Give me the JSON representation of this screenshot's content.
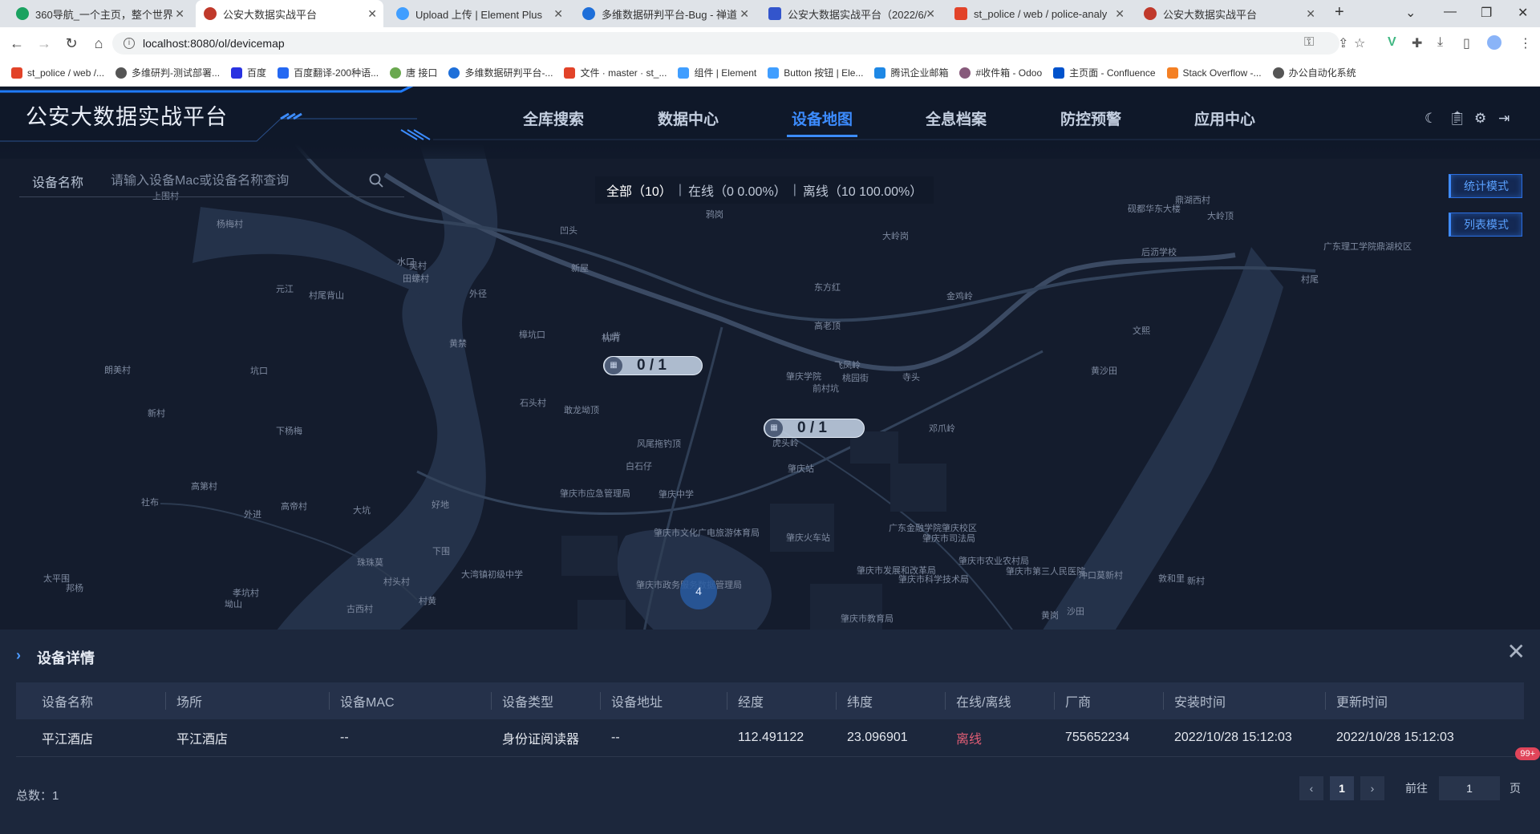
{
  "browser": {
    "tabs": [
      {
        "title": "360导航_一个主页，整个世界",
        "color": "#1aa260"
      },
      {
        "title": "公安大数据实战平台",
        "color": "#c0392b"
      },
      {
        "title": "Upload 上传 | Element Plus",
        "color": "#409eff"
      },
      {
        "title": "多维数据研判平台-Bug - 禅道",
        "color": "#1e6fd9"
      },
      {
        "title": "公安大数据实战平台（2022/6/",
        "color": "#3355cc"
      },
      {
        "title": "st_police / web / police-analy",
        "color": "#e24329"
      },
      {
        "title": "公安大数据实战平台",
        "color": "#c0392b"
      }
    ],
    "new_tab": "+",
    "url": "localhost:8080/ol/devicemap",
    "bookmarks": [
      {
        "label": "st_police / web /...",
        "color": "#e24329"
      },
      {
        "label": "多维研判-测试部署...",
        "color": "#555"
      },
      {
        "label": "百度",
        "color": "#2932e1"
      },
      {
        "label": "百度翻译-200种语...",
        "color": "#2468f2"
      },
      {
        "label": "唐 接口",
        "color": "#6aa84f"
      },
      {
        "label": "多维数据研判平台-...",
        "color": "#1e6fd9"
      },
      {
        "label": "文件 · master · st_...",
        "color": "#e24329"
      },
      {
        "label": "组件 | Element",
        "color": "#409eff"
      },
      {
        "label": "Button 按钮 | Ele...",
        "color": "#409eff"
      },
      {
        "label": "腾讯企业邮箱",
        "color": "#1e88e5"
      },
      {
        "label": "#收件箱 - Odoo",
        "color": "#875a7b"
      },
      {
        "label": "主页面 - Confluence",
        "color": "#0052cc"
      },
      {
        "label": "Stack Overflow -...",
        "color": "#f48024"
      },
      {
        "label": "办公自动化系统",
        "color": "#555"
      }
    ]
  },
  "app": {
    "title": "公安大数据实战平台",
    "nav": [
      "全库搜索",
      "数据中心",
      "设备地图",
      "全息档案",
      "防控预警",
      "应用中心"
    ],
    "active_nav": "设备地图"
  },
  "search": {
    "label": "设备名称",
    "placeholder": "请输入设备Mac或设备名称查询"
  },
  "status": {
    "all": "全部（10）",
    "online": "在线（0   0.00%）",
    "offline": "离线（10   100.00%）"
  },
  "modes": {
    "stats": "统计模式",
    "list": "列表模式"
  },
  "clusters": [
    {
      "label": "0 / 1"
    },
    {
      "label": "0 / 1"
    }
  ],
  "cluster_count": "4",
  "detail": {
    "title": "设备详情",
    "columns": [
      "设备名称",
      "场所",
      "设备MAC",
      "设备类型",
      "设备地址",
      "经度",
      "纬度",
      "在线/离线",
      "厂商",
      "安装时间",
      "更新时间"
    ],
    "rows": [
      [
        "平江酒店",
        "平江酒店",
        "--",
        "身份证阅读器",
        "--",
        "112.491122",
        "23.096901",
        "离线",
        "755652234",
        "2022/10/28 15:12:03",
        "2022/10/28 15:12:03"
      ]
    ],
    "total": "总数：1",
    "page": "1",
    "goto_label": "前往",
    "goto_value": "1",
    "page_suffix": "页"
  },
  "notif_badge": "99+",
  "map_labels": [
    "上围村",
    "杨梅村",
    "水口",
    "田螺村",
    "村尾背山",
    "吴村",
    "外径",
    "凹头",
    "新屋",
    "樟坑口",
    "山背",
    "杭坑",
    "黄禁",
    "鸦岗",
    "大岭岗",
    "东方红",
    "高老顶",
    "前村坑",
    "飞凤岭",
    "桃园街",
    "肇庆学院",
    "金鸡岭",
    "寺头",
    "石头村",
    "敢龙坳顶",
    "风尾拖钓顶",
    "白石仔",
    "虎头岭",
    "邓爪岭",
    "肇庆中学",
    "肇庆市应急管理局",
    "肇庆站",
    "肇庆火车站",
    "广东金融学院肇庆校区",
    "肇庆市文化广电旅游体育局",
    "肇庆市政务服务数据管理局",
    "肇庆市发展和改革局",
    "肇庆市教育局",
    "肇庆市科学技术局",
    "肇庆市农业农村局",
    "肇庆市司法局",
    "肇庆市第三人民医院",
    "黄岗",
    "沙田",
    "冲口莫新村",
    "敦和里",
    "新村",
    "文熙",
    "黄沙田",
    "鼎湖西村",
    "砚都华东大楼",
    "大岭顶",
    "后沥学校",
    "广东理工学院鼎湖校区",
    "村尾",
    "元江",
    "坑口",
    "下杨梅",
    "朗美村",
    "新村",
    "社布",
    "高第村",
    "外进",
    "高帝村",
    "大坑",
    "珠珠莫",
    "好地",
    "下围",
    "大湾镇初级中学",
    "古西村",
    "村黄",
    "村头村",
    "孝坑村",
    "坳山",
    "太平围",
    "邦杨"
  ]
}
